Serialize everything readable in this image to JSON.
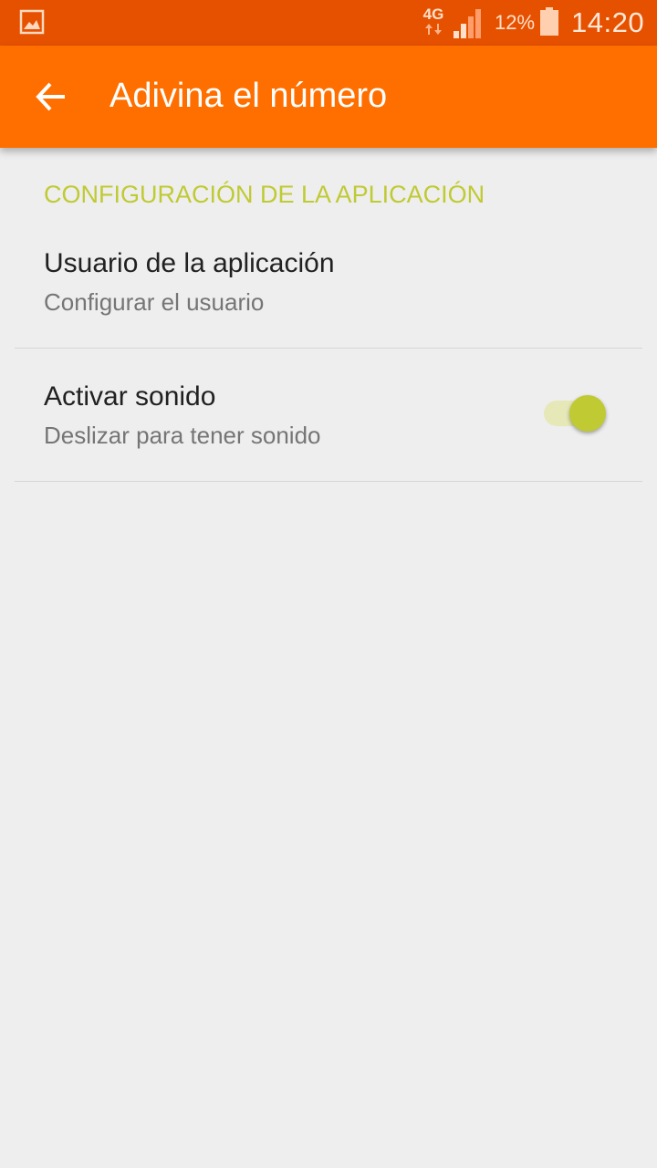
{
  "status_bar": {
    "network": "4G",
    "battery": "12%",
    "time": "14:20",
    "icons": [
      "gallery-icon",
      "network-4g-icon",
      "signal-icon",
      "battery-icon"
    ]
  },
  "app_bar": {
    "title": "Adivina el número",
    "back_icon": "arrow-back-icon"
  },
  "settings": {
    "category": "CONFIGURACIÓN DE LA APLICACIÓN",
    "items": [
      {
        "title": "Usuario de la aplicación",
        "summary": "Configurar el usuario"
      },
      {
        "title": "Activar sonido",
        "summary": "Deslizar para tener sonido",
        "switch_on": true
      }
    ]
  },
  "colors": {
    "status_bar": "#e65100",
    "app_bar": "#ff6f00",
    "accent": "#c0ca33",
    "background": "#eeeeee"
  }
}
